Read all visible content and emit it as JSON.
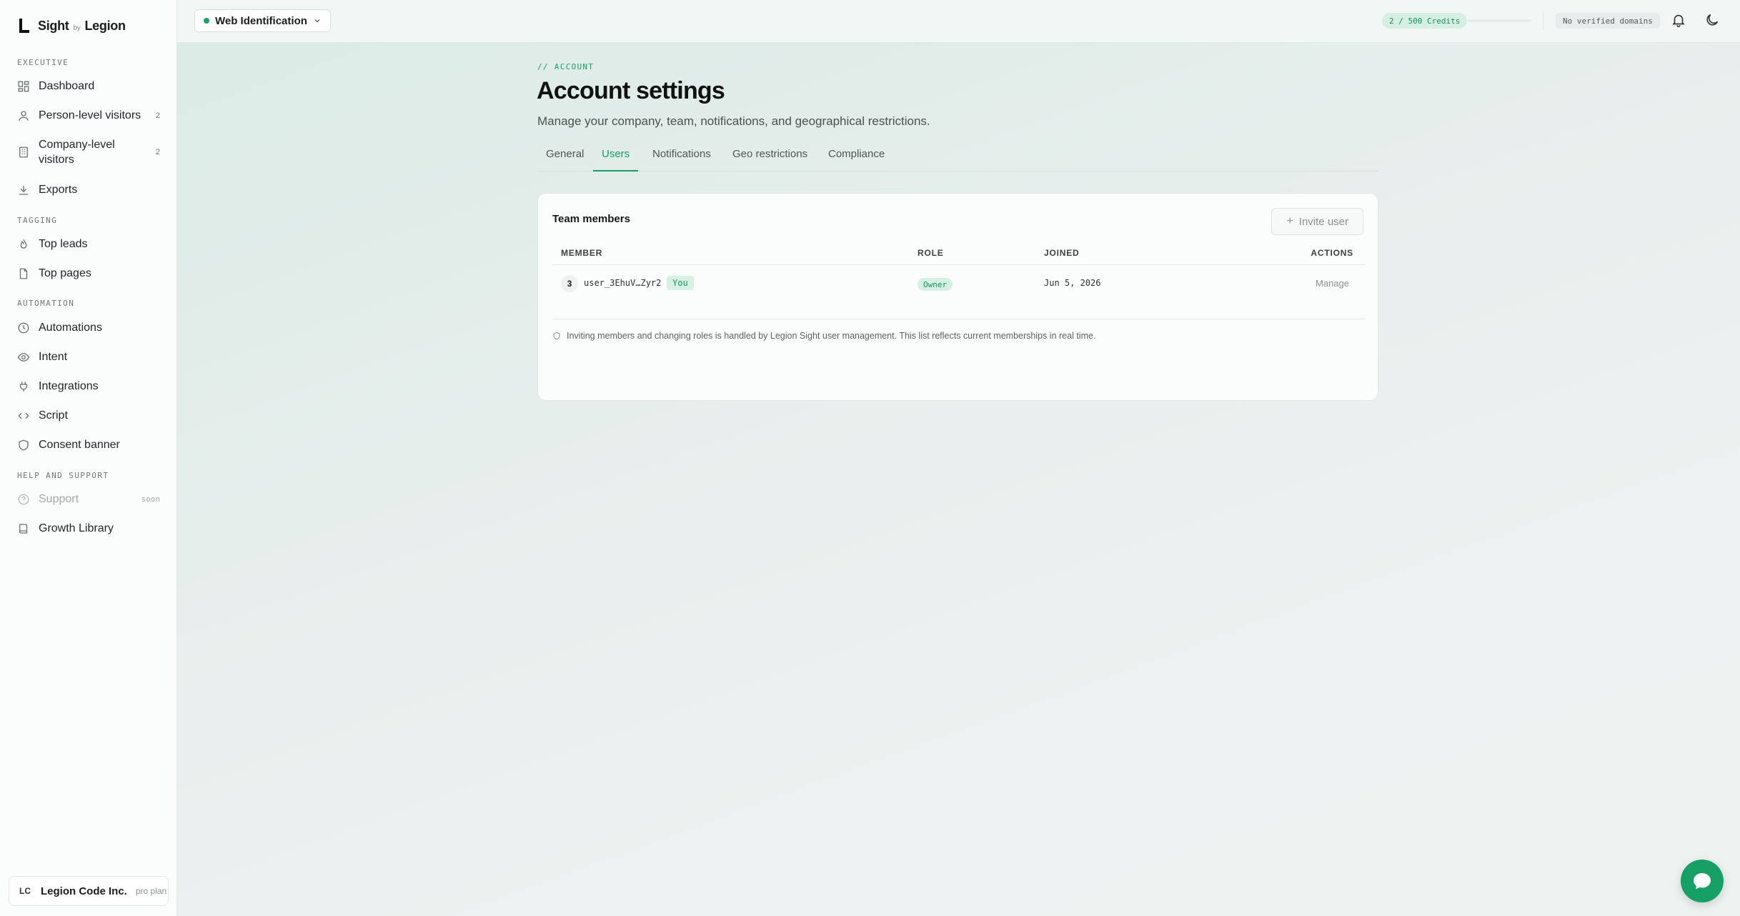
{
  "brand": {
    "name": "Sight",
    "by": "by",
    "company": "Legion"
  },
  "sidebar": {
    "sections": {
      "executive": "EXECUTIVE",
      "tagging": "TAGGING",
      "automation": "AUTOMATION",
      "help": "HELP AND SUPPORT"
    },
    "items": {
      "dashboard": {
        "label": "Dashboard"
      },
      "person_visitors": {
        "label": "Person-level visitors",
        "badge": "2"
      },
      "company_visitors": {
        "label": "Company-level visitors",
        "badge": "2"
      },
      "exports": {
        "label": "Exports"
      },
      "top_leads": {
        "label": "Top leads"
      },
      "top_pages": {
        "label": "Top pages"
      },
      "automations": {
        "label": "Automations"
      },
      "intent": {
        "label": "Intent"
      },
      "integrations": {
        "label": "Integrations"
      },
      "script": {
        "label": "Script"
      },
      "consent_banner": {
        "label": "Consent banner"
      },
      "support": {
        "label": "Support",
        "tag": "soon"
      },
      "growth_library": {
        "label": "Growth Library"
      }
    },
    "org": {
      "initials": "LC",
      "name": "Legion Code Inc.",
      "plan": "pro plan"
    }
  },
  "topbar": {
    "workspace": "Web Identification",
    "credits": "2 / 500 Credits",
    "credits_used_fraction": 0.004,
    "domains": "No verified domains"
  },
  "page": {
    "eyebrow": "// ACCOUNT",
    "title": "Account settings",
    "subtitle": "Manage your company, team, notifications, and geographical restrictions."
  },
  "tabs": {
    "general": "General",
    "users": "Users",
    "notifications": "Notifications",
    "geo": "Geo restrictions",
    "compliance": "Compliance",
    "active": "users"
  },
  "team": {
    "title": "Team members",
    "invite_label": "Invite user",
    "columns": {
      "member": "MEMBER",
      "role": "ROLE",
      "joined": "JOINED",
      "actions": "ACTIONS"
    },
    "rows": [
      {
        "avatar": "3",
        "id": "user_3EhuV…Zyr2",
        "you": "You",
        "role": "Owner",
        "joined": "Jun 5, 2026",
        "action": "Manage"
      }
    ],
    "note": "Inviting members and changing roles is handled by Legion Sight user management. This list reflects current memberships in real time."
  },
  "colors": {
    "accent": "#1a9b67",
    "accent_bg": "#d6f0e3",
    "fab": "#16a066"
  }
}
